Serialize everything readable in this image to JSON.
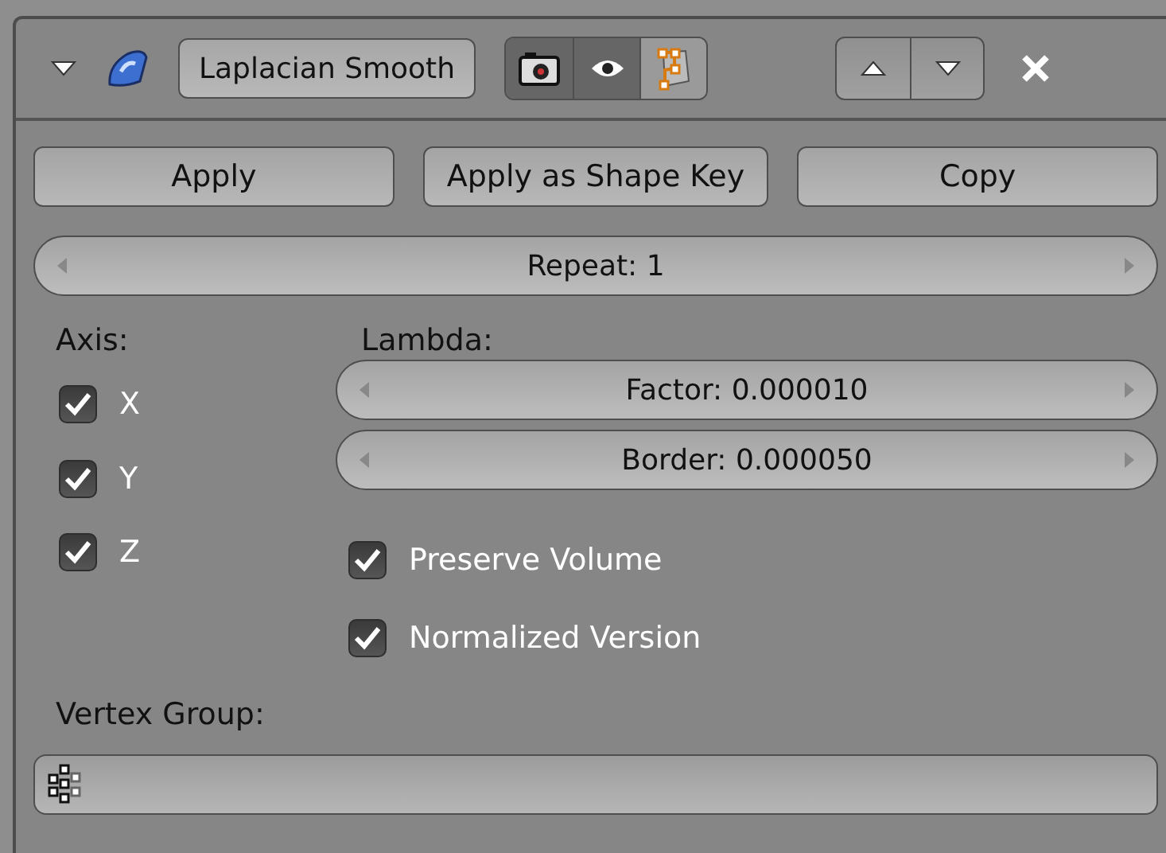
{
  "header": {
    "expanded": true,
    "name": "Laplacian Smooth",
    "toggles": [
      {
        "kind": "render",
        "on": true
      },
      {
        "kind": "viewport",
        "on": true
      },
      {
        "kind": "editmode",
        "on": false
      }
    ]
  },
  "actions": [
    "Apply",
    "Apply as Shape Key",
    "Copy"
  ],
  "repeat": "Repeat: 1",
  "axis": {
    "label": "Axis:",
    "items": [
      {
        "label": "X",
        "checked": true
      },
      {
        "label": "Y",
        "checked": true
      },
      {
        "label": "Z",
        "checked": true
      }
    ]
  },
  "lambda": {
    "label": "Lambda:",
    "fields": [
      "Factor: 0.000010",
      "Border: 0.000050"
    ]
  },
  "options": [
    {
      "label": "Preserve Volume",
      "checked": true
    },
    {
      "label": "Normalized Version",
      "checked": true
    }
  ],
  "vertex_group": {
    "label": "Vertex Group:"
  }
}
